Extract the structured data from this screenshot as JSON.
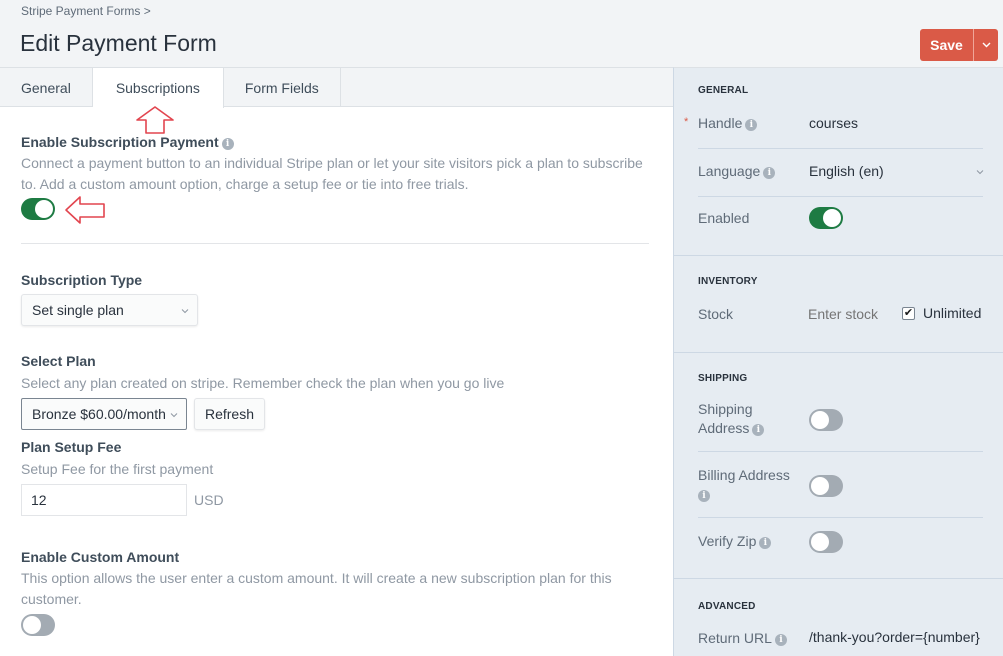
{
  "header": {
    "breadcrumb": "Stripe Payment Forms",
    "breadcrumb_separator": ">",
    "title": "Edit Payment Form",
    "save_label": "Save",
    "save_menu_icon": "chevron-down-icon",
    "accent_color": "#da5a47"
  },
  "tabs": [
    {
      "label": "General",
      "active": false
    },
    {
      "label": "Subscriptions",
      "active": true
    },
    {
      "label": "Form Fields",
      "active": false
    }
  ],
  "main": {
    "enable_subscription": {
      "heading": "Enable Subscription Payment",
      "description_line1": "Connect a payment button to an individual Stripe plan or let your site visitors pick a plan to subscribe",
      "description_line2": "to. Add a custom amount option, charge a setup fee or tie into free trials.",
      "enabled": true
    },
    "subscription_type": {
      "heading": "Subscription Type",
      "selected": "Set single plan"
    },
    "select_plan": {
      "heading": "Select Plan",
      "description": "Select any plan created on stripe. Remember check the plan when you go live",
      "selected": "Bronze $60.00/month",
      "refresh_label": "Refresh"
    },
    "setup_fee": {
      "heading": "Plan Setup Fee",
      "description": "Setup Fee for the first payment",
      "value": "12",
      "unit": "USD"
    },
    "custom_amount": {
      "heading": "Enable Custom Amount",
      "description_line1": "This option allows the user enter a custom amount. It will create a new subscription plan for this",
      "description_line2": "customer.",
      "enabled": false
    }
  },
  "sidebar": {
    "general": {
      "heading": "GENERAL",
      "handle_label": "Handle",
      "handle_value": "courses",
      "required_marker": "*",
      "language_label": "Language",
      "language_value": "English (en)",
      "enabled_label": "Enabled",
      "enabled": true
    },
    "inventory": {
      "heading": "INVENTORY",
      "stock_label": "Stock",
      "stock_placeholder": "Enter stock",
      "unlimited_label": "Unlimited",
      "unlimited_checked": true
    },
    "shipping": {
      "heading": "SHIPPING",
      "shipping_address_label_1": "Shipping",
      "shipping_address_label_2": "Address",
      "shipping_address_enabled": false,
      "billing_address_label": "Billing Address",
      "billing_address_enabled": false,
      "verify_zip_label": "Verify Zip",
      "verify_zip_enabled": false
    },
    "advanced": {
      "heading": "ADVANCED",
      "return_url_label": "Return URL",
      "return_url_value": "/thank-you?order={number}"
    }
  },
  "icons": {
    "info": "i",
    "chevron": "⌄",
    "check": "✔"
  }
}
